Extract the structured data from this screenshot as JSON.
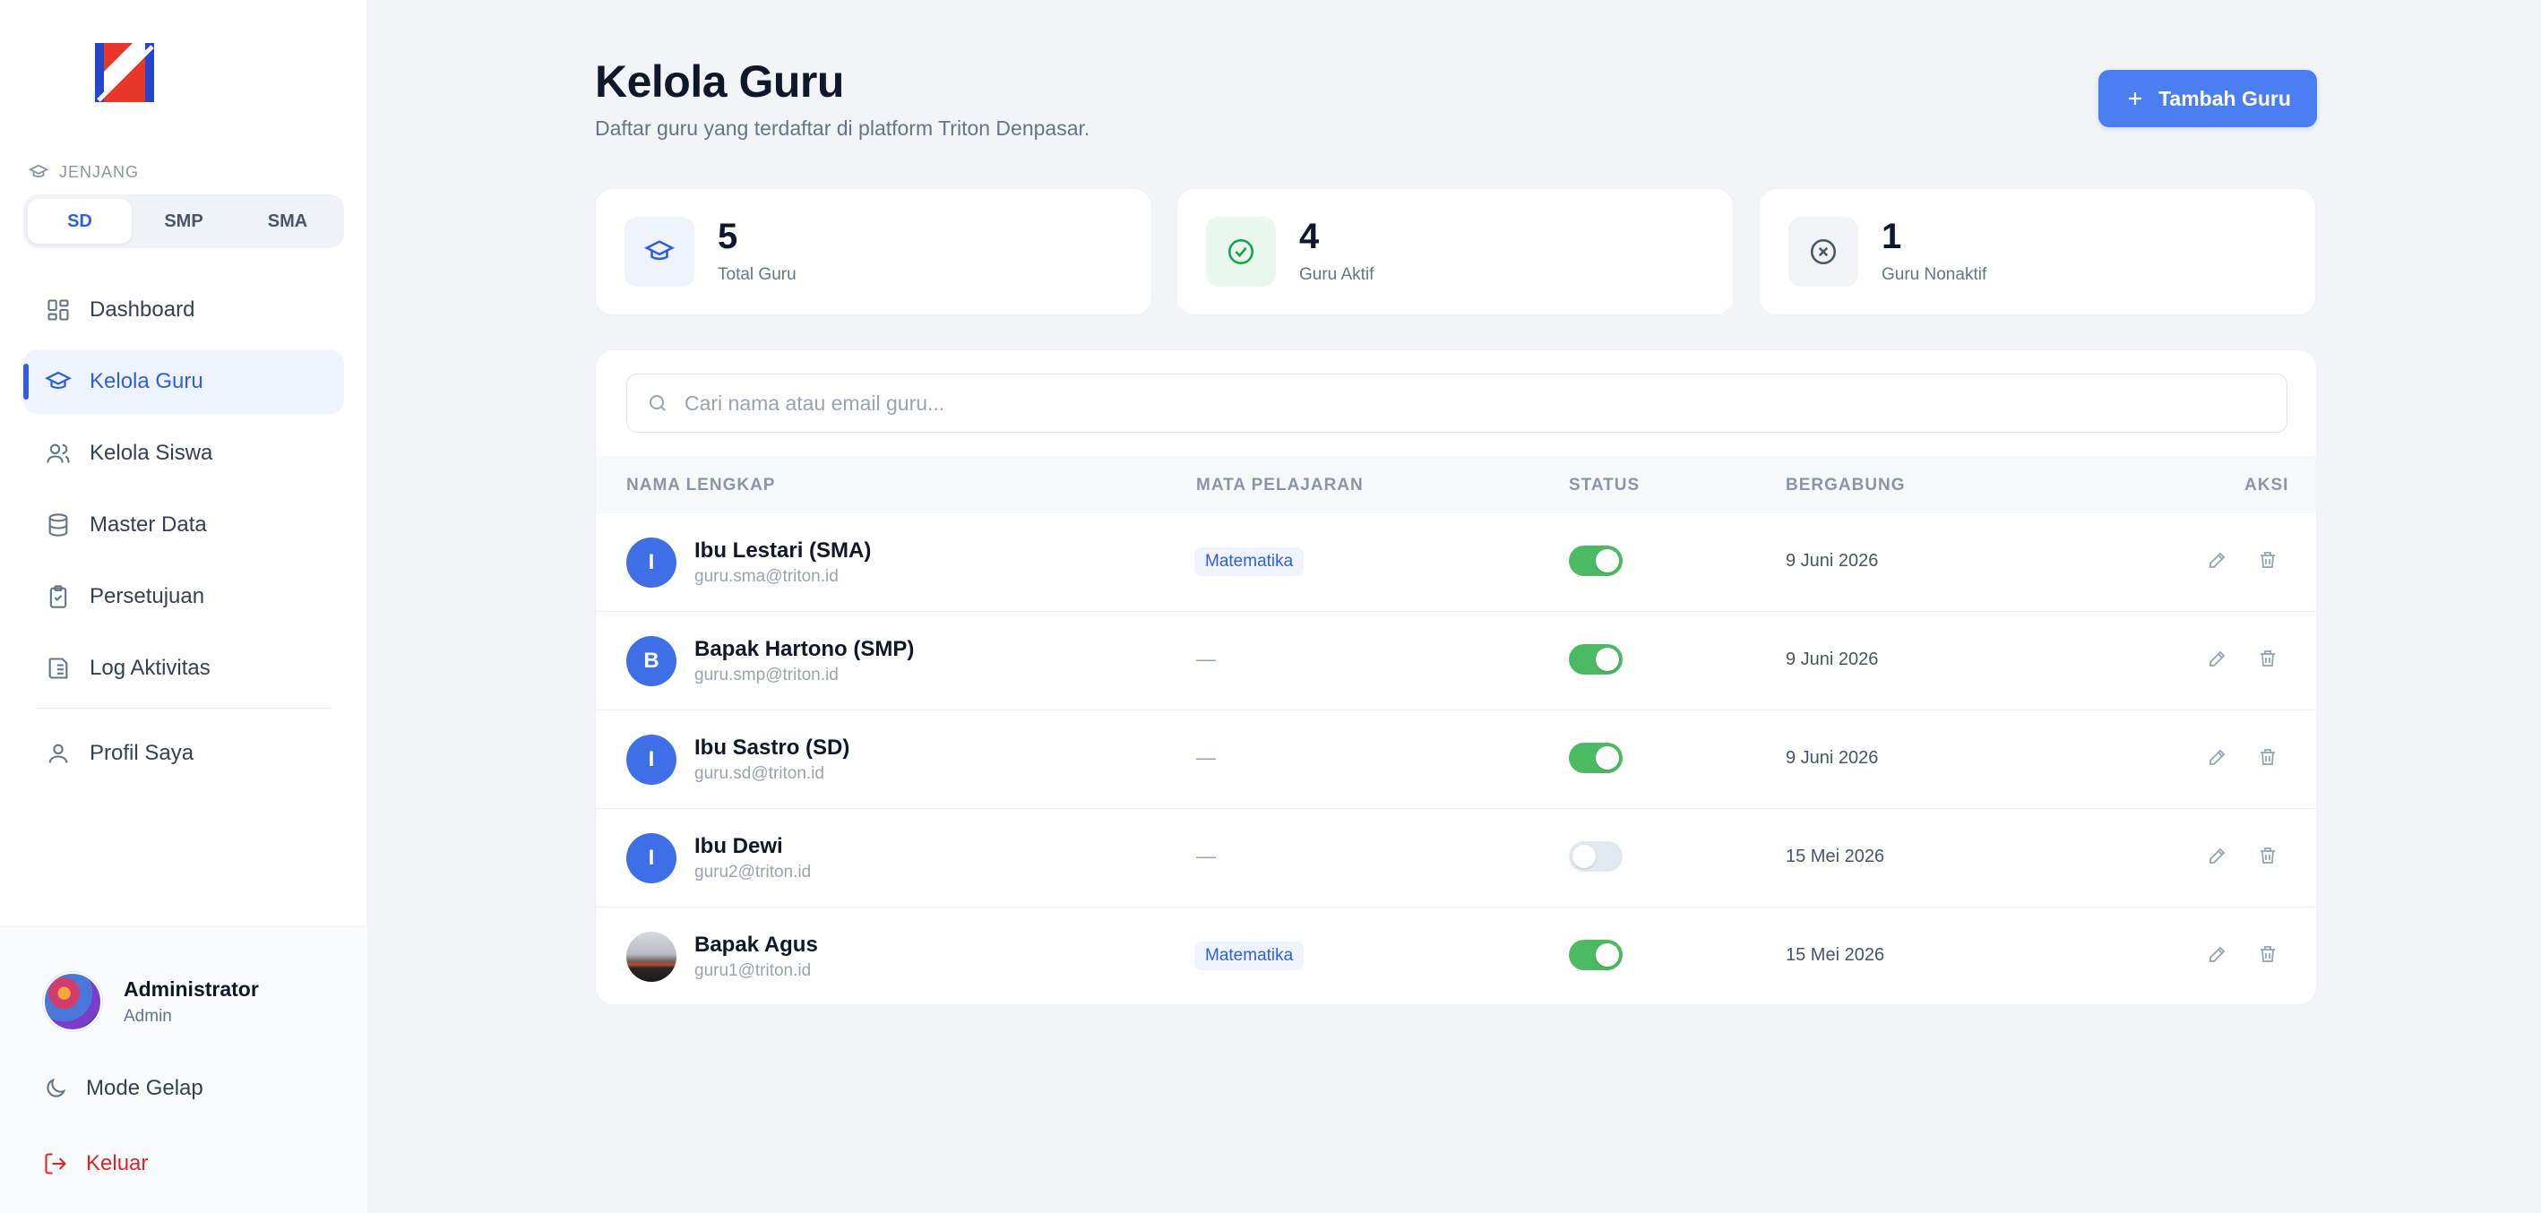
{
  "sidebar": {
    "jenjang_label": "JENJANG",
    "jenjang_options": [
      "SD",
      "SMP",
      "SMA"
    ],
    "jenjang_selected": "SD",
    "nav": [
      {
        "label": "Dashboard",
        "icon": "dashboard-icon"
      },
      {
        "label": "Kelola Guru",
        "icon": "graduation-cap-icon",
        "active": true
      },
      {
        "label": "Kelola Siswa",
        "icon": "users-icon"
      },
      {
        "label": "Master Data",
        "icon": "database-icon"
      },
      {
        "label": "Persetujuan",
        "icon": "clipboard-check-icon"
      },
      {
        "label": "Log Aktivitas",
        "icon": "log-icon"
      }
    ],
    "profile_link": {
      "label": "Profil Saya",
      "icon": "user-icon"
    },
    "user": {
      "name": "Administrator",
      "role": "Admin"
    },
    "dark_mode_label": "Mode Gelap",
    "logout_label": "Keluar"
  },
  "header": {
    "title": "Kelola Guru",
    "subtitle": "Daftar guru yang terdaftar di platform Triton Denpasar.",
    "add_button_label": "Tambah Guru"
  },
  "stats": [
    {
      "value": "5",
      "label": "Total Guru",
      "icon": "graduation-cap-icon",
      "color": "#2f5fe0"
    },
    {
      "value": "4",
      "label": "Guru Aktif",
      "icon": "check-circle-icon",
      "color": "#16a34a"
    },
    {
      "value": "1",
      "label": "Guru Nonaktif",
      "icon": "x-circle-icon",
      "color": "#475569"
    }
  ],
  "search": {
    "placeholder": "Cari nama atau email guru..."
  },
  "table": {
    "headers": [
      "NAMA LENGKAP",
      "MATA PELAJARAN",
      "STATUS",
      "BERGABUNG",
      "AKSI"
    ],
    "rows": [
      {
        "initial": "I",
        "name": "Ibu Lestari (SMA)",
        "email": "guru.sma@triton.id",
        "subject": "Matematika",
        "active": true,
        "joined": "9 Juni 2026"
      },
      {
        "initial": "B",
        "name": "Bapak Hartono (SMP)",
        "email": "guru.smp@triton.id",
        "subject": "—",
        "active": true,
        "joined": "9 Juni 2026"
      },
      {
        "initial": "I",
        "name": "Ibu Sastro (SD)",
        "email": "guru.sd@triton.id",
        "subject": "—",
        "active": true,
        "joined": "9 Juni 2026"
      },
      {
        "initial": "I",
        "name": "Ibu Dewi",
        "email": "guru2@triton.id",
        "subject": "—",
        "active": false,
        "joined": "15 Mei 2026"
      },
      {
        "initial": "",
        "name": "Bapak Agus",
        "email": "guru1@triton.id",
        "subject": "Matematika",
        "active": true,
        "joined": "15 Mei 2026"
      }
    ]
  },
  "colors": {
    "accent": "#4a7ef1",
    "active_toggle": "#4cba63",
    "danger": "#dc2626"
  }
}
